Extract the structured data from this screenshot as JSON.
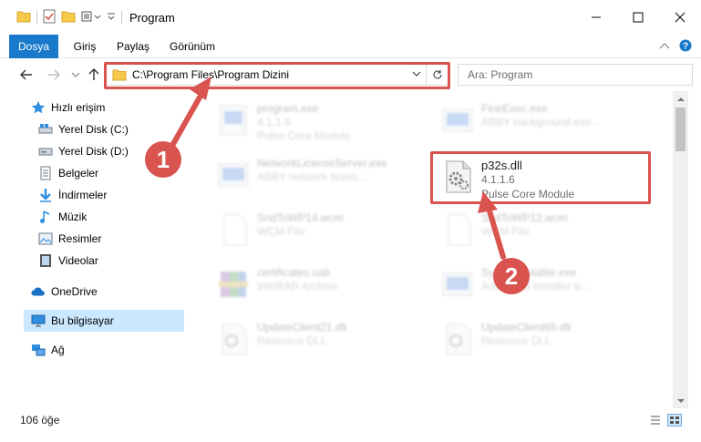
{
  "window": {
    "title": "Program"
  },
  "ribbon": {
    "tabs": [
      "Dosya",
      "Giriş",
      "Paylaş",
      "Görünüm"
    ]
  },
  "address": {
    "path": "C:\\Program Files\\Program Dizini"
  },
  "search": {
    "placeholder": "Ara: Program"
  },
  "sidebar": {
    "items": [
      {
        "label": "Hızlı erişim",
        "icon": "star-icon"
      },
      {
        "label": "Yerel Disk (C:)",
        "icon": "drive-icon"
      },
      {
        "label": "Yerel Disk (D:)",
        "icon": "drive-icon"
      },
      {
        "label": "Belgeler",
        "icon": "documents-icon"
      },
      {
        "label": "İndirmeler",
        "icon": "download-icon"
      },
      {
        "label": "Müzik",
        "icon": "music-icon"
      },
      {
        "label": "Resimler",
        "icon": "pictures-icon"
      },
      {
        "label": "Videolar",
        "icon": "video-icon"
      },
      {
        "label": "OneDrive",
        "icon": "cloud-icon"
      },
      {
        "label": "Bu bilgisayar",
        "icon": "computer-icon"
      },
      {
        "label": "Ağ",
        "icon": "network-icon"
      }
    ]
  },
  "files": [
    {
      "name": "program.exe",
      "line2": "4.1.1.6",
      "line3": "Pulse Core Module"
    },
    {
      "name": "FineExec.exe",
      "line2": "ABBY background exe...",
      "line3": ""
    },
    {
      "name": "NetworkLicenseServer.exe",
      "line2": "ABBY network licens...",
      "line3": ""
    },
    {
      "name": "p32s.dll",
      "line2": "4.1.1.6",
      "line3": "Pulse Core Module"
    },
    {
      "name": "SndToWP14.wcm",
      "line2": "WCM File",
      "line3": ""
    },
    {
      "name": "SndToWP12.wcm",
      "line2": "WCM File",
      "line3": ""
    },
    {
      "name": "certificates.cab",
      "line2": "WinRAR Archive",
      "line3": ""
    },
    {
      "name": "SystemInstaller.exe",
      "line2": "Advanced Installer tr...",
      "line3": ""
    },
    {
      "name": "UpdateClient21.dll",
      "line2": "Resource DLL",
      "line3": ""
    },
    {
      "name": "UpdateClient65.dll",
      "line2": "Resource DLL",
      "line3": ""
    }
  ],
  "status": {
    "count": "106 öğe"
  },
  "annotations": {
    "step1": "1",
    "step2": "2"
  },
  "colors": {
    "accent": "#1979ca",
    "annotation": "#d9534f",
    "selected": "#cce8ff"
  }
}
